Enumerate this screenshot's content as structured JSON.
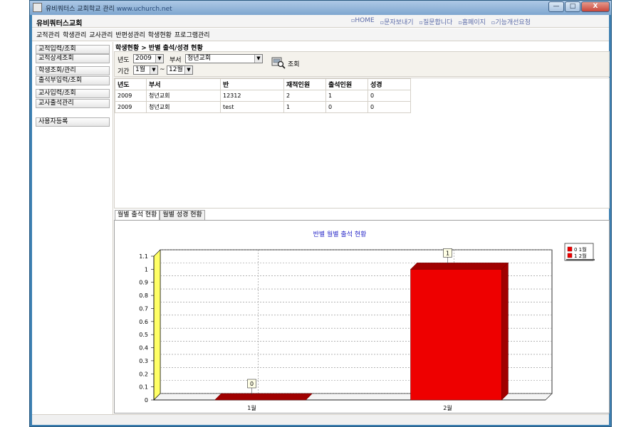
{
  "window": {
    "title": "유비쿼터스 교회학교 관리",
    "url": "www.uchurch.net",
    "minimize": "—",
    "maximize": "□",
    "close": "X"
  },
  "header": {
    "brand": "유비쿼터스교회",
    "links": [
      "HOME",
      "문자보내기",
      "질문합니다",
      "홈페이지",
      "기능개선요청"
    ]
  },
  "menu": [
    "교적관리",
    "학생관리",
    "교사관리",
    "반편성관리",
    "학생현황",
    "프로그램관리"
  ],
  "sidebar": [
    "교적입력/조회",
    "교적상세조회",
    "학생조회/관리",
    "출석부입력/조회",
    "교사입력/조회",
    "교사출석관리",
    "사용자등록"
  ],
  "breadcrumb": "학생현황 > 반별 출석/성경 현황",
  "filter": {
    "year_label": "년도",
    "year_value": "2009",
    "dept_label": "부서",
    "dept_value": "청년교회",
    "period_label": "기간",
    "from_month": "1월",
    "tilde": "~",
    "to_month": "12월",
    "search_label": "조회"
  },
  "table": {
    "headers": [
      "년도",
      "부서",
      "반",
      "재적인원",
      "출석인원",
      "성경"
    ],
    "rows": [
      [
        "2009",
        "청년교회",
        "12312",
        "2",
        "1",
        "0"
      ],
      [
        "2009",
        "청년교회",
        "test",
        "1",
        "0",
        "0"
      ]
    ]
  },
  "tabs": [
    "월별 출석 현황",
    "월별 성경 현황"
  ],
  "colors": {
    "bar": "#ee0000",
    "bar_dark": "#a00000",
    "title": "#2929c8",
    "wall_left": "#ffff66"
  },
  "chart_data": {
    "type": "bar",
    "title": "반별 월별 출석 현황",
    "categories": [
      "1월",
      "2월"
    ],
    "values": [
      0,
      1
    ],
    "data_labels": [
      "0",
      "1"
    ],
    "legend": [
      "0 1월",
      "1 2월"
    ],
    "legend_position": "top-right",
    "ylim": [
      0,
      1.1
    ],
    "yticks": [
      "0",
      "0.1",
      "0.2",
      "0.3",
      "0.4",
      "0.5",
      "0.6",
      "0.7",
      "0.8",
      "0.9",
      "1",
      "1.1"
    ],
    "grid": true
  }
}
